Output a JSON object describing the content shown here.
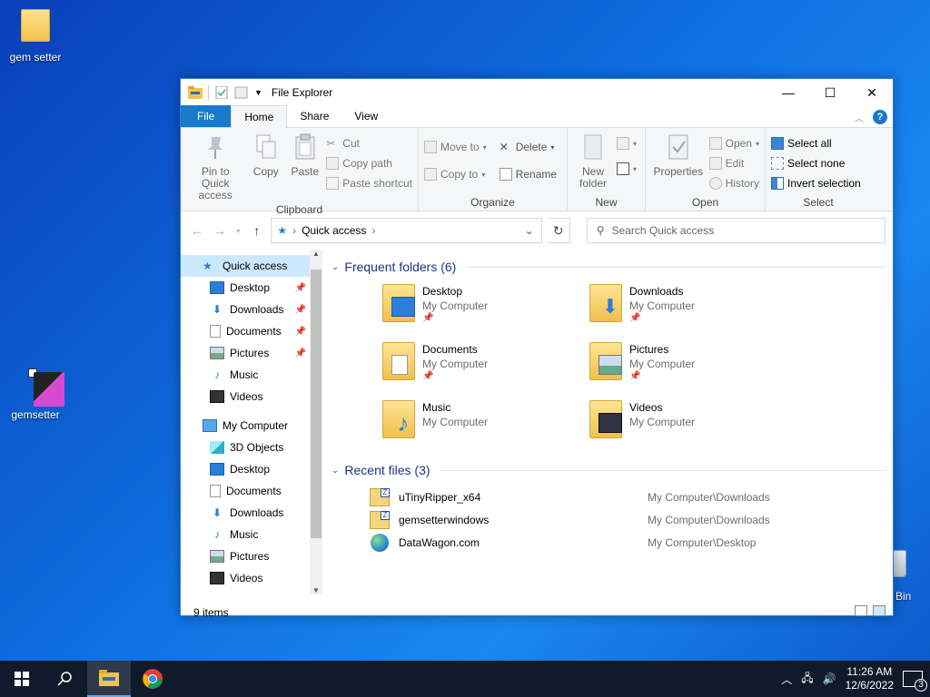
{
  "desktop": {
    "icons": [
      {
        "label": "gem setter"
      },
      {
        "label": "gemsetter"
      }
    ],
    "recycle_label": "Bin"
  },
  "window": {
    "title": "File Explorer",
    "controls": {
      "minimize": "—",
      "maximize": "☐",
      "close": "✕"
    }
  },
  "ribbon": {
    "tabs": [
      "File",
      "Home",
      "Share",
      "View"
    ],
    "clipboard": {
      "pin": "Pin to Quick access",
      "copy": "Copy",
      "paste": "Paste",
      "cut": "Cut",
      "copy_path": "Copy path",
      "paste_shortcut": "Paste shortcut",
      "label": "Clipboard"
    },
    "organize": {
      "move_to": "Move to",
      "copy_to": "Copy to",
      "delete": "Delete",
      "rename": "Rename",
      "label": "Organize"
    },
    "new": {
      "new_folder": "New folder",
      "label": "New"
    },
    "open": {
      "properties": "Properties",
      "open": "Open",
      "edit": "Edit",
      "history": "History",
      "label": "Open"
    },
    "select": {
      "select_all": "Select all",
      "select_none": "Select none",
      "invert": "Invert selection",
      "label": "Select"
    }
  },
  "address": {
    "path": "Quick access",
    "search_placeholder": "Search Quick access"
  },
  "navpane": {
    "quick_access": "Quick access",
    "quick_items": [
      {
        "label": "Desktop",
        "pinned": true
      },
      {
        "label": "Downloads",
        "pinned": true
      },
      {
        "label": "Documents",
        "pinned": true
      },
      {
        "label": "Pictures",
        "pinned": true
      },
      {
        "label": "Music",
        "pinned": false
      },
      {
        "label": "Videos",
        "pinned": false
      }
    ],
    "computer": "My Computer",
    "computer_items": [
      "3D Objects",
      "Desktop",
      "Documents",
      "Downloads",
      "Music",
      "Pictures",
      "Videos"
    ]
  },
  "frequent": {
    "header": "Frequent folders (6)",
    "folders": [
      {
        "name": "Desktop",
        "location": "My Computer"
      },
      {
        "name": "Downloads",
        "location": "My Computer"
      },
      {
        "name": "Documents",
        "location": "My Computer"
      },
      {
        "name": "Pictures",
        "location": "My Computer"
      },
      {
        "name": "Music",
        "location": "My Computer"
      },
      {
        "name": "Videos",
        "location": "My Computer"
      }
    ]
  },
  "recent": {
    "header": "Recent files (3)",
    "files": [
      {
        "name": "uTinyRipper_x64",
        "location": "My Computer\\Downloads"
      },
      {
        "name": "gemsetterwindows",
        "location": "My Computer\\Downloads"
      },
      {
        "name": "DataWagon.com",
        "location": "My Computer\\Desktop"
      }
    ]
  },
  "status": {
    "items": "9 items"
  },
  "taskbar": {
    "time": "11:26 AM",
    "date": "12/6/2022",
    "notifications": "3"
  },
  "colors": {
    "accent": "#1979ca",
    "selection": "#cce8ff",
    "section_header": "#1e3287"
  }
}
